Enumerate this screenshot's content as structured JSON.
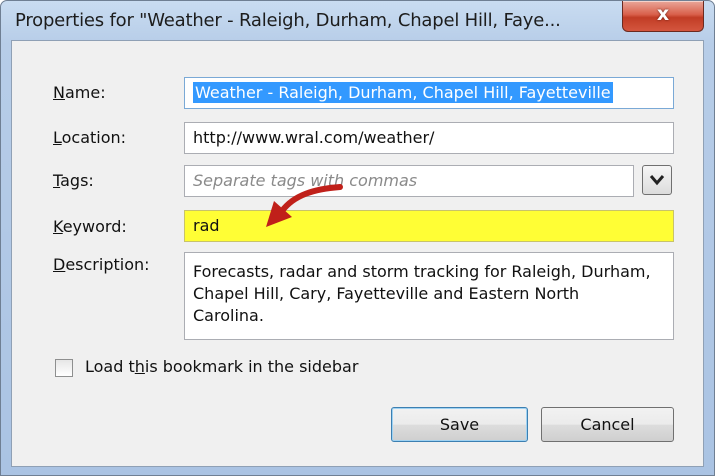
{
  "window": {
    "title": "Properties for \"Weather - Raleigh, Durham, Chapel Hill, Faye...",
    "close_glyph": "x"
  },
  "form": {
    "name": {
      "label_ul": "N",
      "label_rest": "ame:",
      "value": "Weather - Raleigh, Durham, Chapel Hill, Fayetteville"
    },
    "location": {
      "label_ul": "L",
      "label_rest": "ocation:",
      "value": "http://www.wral.com/weather/"
    },
    "tags": {
      "label_ul": "T",
      "label_rest": "ags:",
      "placeholder": "Separate tags with commas"
    },
    "keyword": {
      "label_ul": "K",
      "label_rest": "eyword:",
      "value": "rad",
      "highlight": "#fffe35"
    },
    "description": {
      "label_ul": "D",
      "label_rest": "escription:",
      "value": "Forecasts, radar and storm tracking for Raleigh, Durham, Chapel Hill, Cary, Fayetteville and Eastern North Carolina."
    }
  },
  "sidebar_option": {
    "label_a": "Load t",
    "label_ul": "h",
    "label_b": "is bookmark in the sidebar",
    "checked": false
  },
  "buttons": {
    "save": "Save",
    "cancel": "Cancel"
  },
  "icons": {
    "close": "close-icon",
    "dropdown": "chevron-down-icon",
    "annotation": "red-arrow-icon"
  },
  "colors": {
    "annotation_arrow": "#c0201a",
    "selection": "#3399ff"
  }
}
